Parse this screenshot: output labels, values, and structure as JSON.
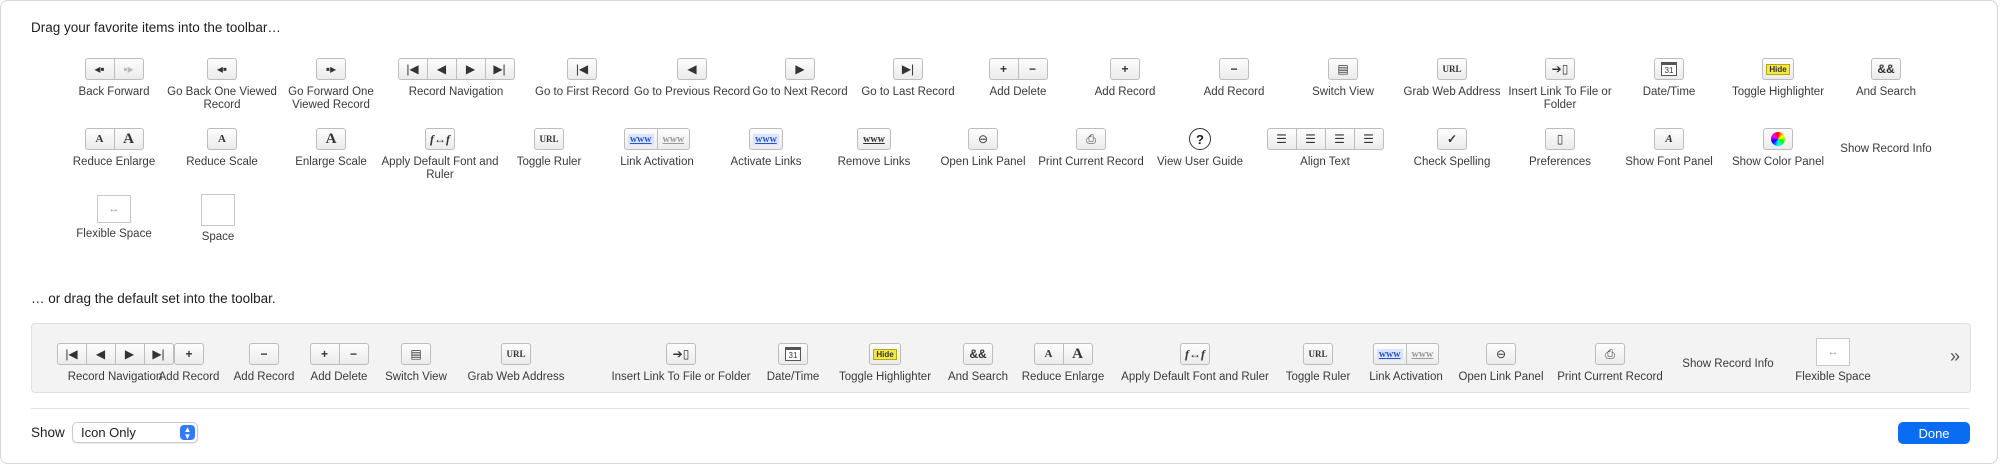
{
  "heading_favorites": "Drag your favorite items into the toolbar…",
  "heading_default": "… or drag the default set into the toolbar.",
  "palette": {
    "back_forward": "Back Forward",
    "go_back_one": "Go Back One Viewed Record",
    "go_forward_one": "Go Forward One Viewed Record",
    "record_navigation": "Record Navigation",
    "go_first": "Go to First Record",
    "go_previous": "Go to Previous Record",
    "go_next": "Go to Next Record",
    "go_last": "Go to Last Record",
    "add_delete": "Add Delete",
    "add_record": "Add Record",
    "add_record_2": "Add Record",
    "switch_view": "Switch View",
    "grab_web": "Grab Web Address",
    "insert_link": "Insert Link To File or Folder",
    "date_time": "Date/Time",
    "toggle_highlighter": "Toggle Highlighter",
    "and_search": "And Search",
    "reduce_enlarge": "Reduce Enlarge",
    "reduce_scale": "Reduce Scale",
    "enlarge_scale": "Enlarge Scale",
    "apply_default_font": "Apply Default Font and Ruler",
    "toggle_ruler": "Toggle Ruler",
    "link_activation": "Link Activation",
    "activate_links": "Activate Links",
    "remove_links": "Remove Links",
    "open_link_panel": "Open Link Panel",
    "print_current": "Print Current Record",
    "view_user_guide": "View User Guide",
    "align_text": "Align Text",
    "check_spelling": "Check Spelling",
    "preferences": "Preferences",
    "show_font_panel": "Show Font Panel",
    "show_color_panel": "Show Color Panel",
    "show_record_info": "Show Record Info",
    "flexible_space": "Flexible Space",
    "space": "Space"
  },
  "default_set": {
    "record_navigation": "Record Navigation",
    "add_record": "Add Record",
    "add_record_2": "Add Record",
    "add_delete": "Add Delete",
    "switch_view": "Switch View",
    "grab_web": "Grab Web Address",
    "insert_link": "Insert Link To File or Folder",
    "date_time": "Date/Time",
    "toggle_highlighter": "Toggle Highlighter",
    "and_search": "And Search",
    "reduce_enlarge": "Reduce Enlarge",
    "apply_default_font": "Apply Default Font and Ruler",
    "toggle_ruler": "Toggle Ruler",
    "link_activation": "Link Activation",
    "open_link_panel": "Open Link Panel",
    "print_current": "Print Current Record",
    "show_record_info": "Show Record Info",
    "flexible_space": "Flexible Space"
  },
  "glyphs": {
    "www": "www",
    "hide": "Hide",
    "cal_day": "31",
    "url": "URL",
    "ff": "f↔f",
    "and_amp": "&&",
    "letter_a": "A",
    "question": "?",
    "check": "✓",
    "chevron": "»",
    "select_up": "▲",
    "select_down": "▼"
  },
  "footer": {
    "show_label": "Show",
    "show_value": "Icon Only",
    "done_label": "Done"
  },
  "colors": {
    "accent": "#0a6cf0",
    "highlighter": "#f3e74a"
  }
}
